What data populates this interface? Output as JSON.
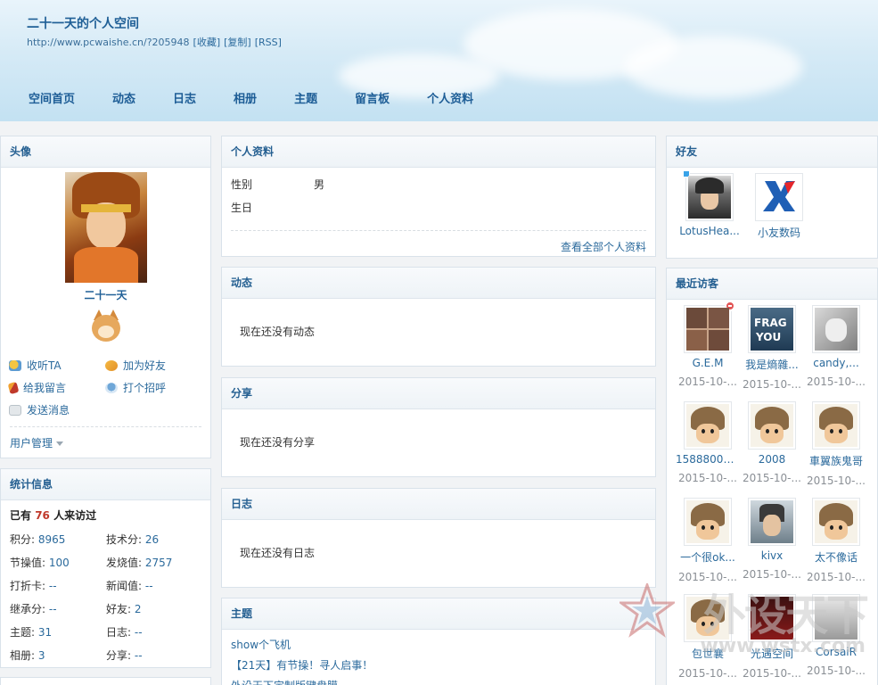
{
  "header": {
    "title": "二十一天的个人空间",
    "url": "http://www.pcwaishe.cn/?205948",
    "url_links": [
      "[收藏]",
      "[复制]",
      "[RSS]"
    ],
    "nav": [
      "空间首页",
      "动态",
      "日志",
      "相册",
      "主题",
      "留言板",
      "个人资料"
    ]
  },
  "avatar_panel": {
    "title": "头像",
    "username": "二十一天",
    "actions": [
      "收听TA",
      "加为好友",
      "给我留言",
      "打个招呼",
      "发送消息"
    ],
    "user_mgmt": "用户管理"
  },
  "stats_panel": {
    "title": "统计信息",
    "visit_prefix": "已有",
    "visit_count": "76",
    "visit_suffix": "人来访过",
    "items": [
      {
        "label": "积分:",
        "value": "8965"
      },
      {
        "label": "技术分:",
        "value": "26"
      },
      {
        "label": "节操值:",
        "value": "100"
      },
      {
        "label": "发烧值:",
        "value": "2757"
      },
      {
        "label": "打折卡:",
        "value": "--"
      },
      {
        "label": "新闻值:",
        "value": "--"
      },
      {
        "label": "继承分:",
        "value": "--"
      },
      {
        "label": "好友:",
        "value": "2"
      },
      {
        "label": "主题:",
        "value": "31"
      },
      {
        "label": "日志:",
        "value": "--"
      },
      {
        "label": "相册:",
        "value": "3"
      },
      {
        "label": "分享:",
        "value": "--"
      }
    ]
  },
  "profile_panel": {
    "title": "个人资料",
    "rows": [
      {
        "label": "性别",
        "value": "男"
      },
      {
        "label": "生日",
        "value": ""
      }
    ],
    "more": "查看全部个人资料"
  },
  "feed_panel": {
    "title": "动态",
    "empty": "现在还没有动态"
  },
  "share_panel": {
    "title": "分享",
    "empty": "现在还没有分享"
  },
  "blog_panel": {
    "title": "日志",
    "empty": "现在还没有日志"
  },
  "topic_panel": {
    "title": "主题",
    "items": [
      "show个飞机",
      "【21天】有节操！寻人启事！",
      "外设天下定制版键盘膜"
    ]
  },
  "friends_panel": {
    "title": "好友",
    "items": [
      "LotusHea...",
      "小友数码"
    ]
  },
  "visitors_panel": {
    "title": "最近访客",
    "items": [
      {
        "name": "G.E.M",
        "date": "2015-10-..."
      },
      {
        "name": "我是熵雜...",
        "date": "2015-10-..."
      },
      {
        "name": "candy,...",
        "date": "2015-10-..."
      },
      {
        "name": "15888009...",
        "date": "2015-10-..."
      },
      {
        "name": "2008",
        "date": "2015-10-..."
      },
      {
        "name": "車翼族鬼哥",
        "date": "2015-10-..."
      },
      {
        "name": "一个很ok...",
        "date": "2015-10-..."
      },
      {
        "name": "kivx",
        "date": "2015-10-..."
      },
      {
        "name": "太不像话",
        "date": "2015-10-..."
      },
      {
        "name": "包世襄",
        "date": "2015-10-..."
      },
      {
        "name": "光遇空间",
        "date": "2015-10-..."
      },
      {
        "name": "CorsaiR",
        "date": "2015-10-..."
      }
    ]
  },
  "friend_logo_text": "小友数码",
  "watermark": {
    "text": "外设天下",
    "url": "www.wstx.com"
  }
}
